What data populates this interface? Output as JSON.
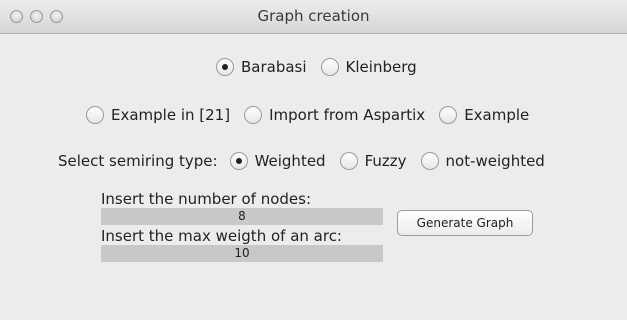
{
  "window": {
    "title": "Graph creation"
  },
  "generator": {
    "options": [
      {
        "label": "Barabasi",
        "selected": true
      },
      {
        "label": "Kleinberg",
        "selected": false
      }
    ]
  },
  "source": {
    "options": [
      {
        "label": "Example in [21]",
        "selected": false
      },
      {
        "label": "Import from Aspartix",
        "selected": false
      },
      {
        "label": "Example",
        "selected": false
      }
    ]
  },
  "semiring": {
    "label": "Select semiring type:",
    "options": [
      {
        "label": "Weighted",
        "selected": true
      },
      {
        "label": "Fuzzy",
        "selected": false
      },
      {
        "label": "not-weighted",
        "selected": false
      }
    ]
  },
  "nodes": {
    "label": "Insert the number of nodes:",
    "value": "8"
  },
  "max_weight": {
    "label": "Insert the max weigth of an arc:",
    "value": "10"
  },
  "generate_button": {
    "label": "Generate Graph"
  }
}
